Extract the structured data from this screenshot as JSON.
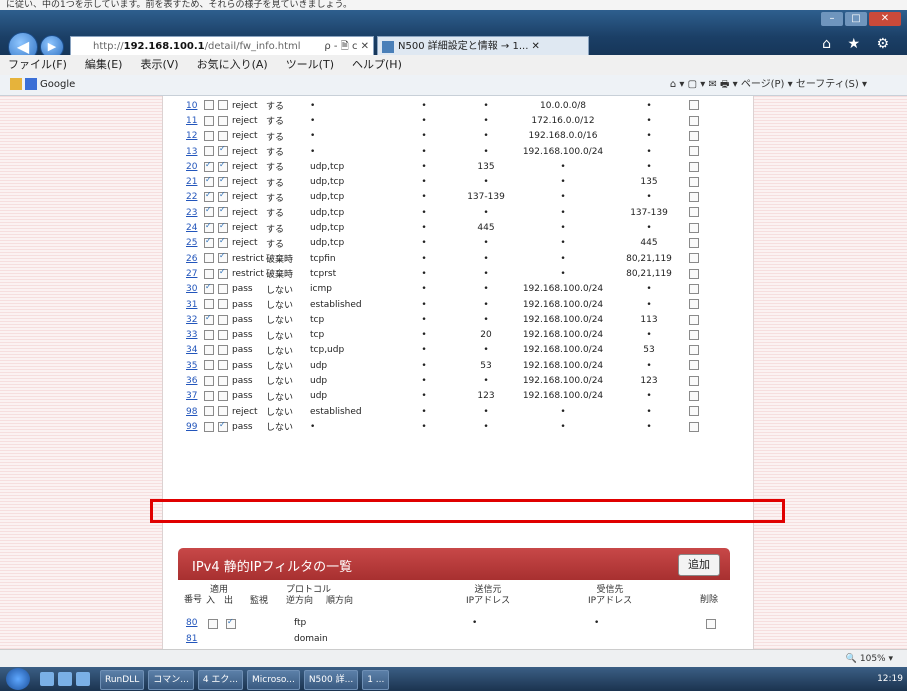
{
  "top_caption": "に従い、中の1つを示しています。前を表すため、それらの様子を見ていきましょう。",
  "window": {
    "minimize": "–",
    "maximize": "□",
    "close": "✕"
  },
  "nav": {
    "back": "◀",
    "forward": "▶"
  },
  "address": {
    "url_prefix": "http://",
    "host": "192.168.100.1",
    "path": "/detail/fw_info.html",
    "controls": "ρ - 🗎 c ✕"
  },
  "tab": {
    "title": "N500 詳細設定と情報 → 1... ✕"
  },
  "top_right_icons": "⌂ ★ ⚙",
  "menu": [
    "ファイル(F)",
    "編集(E)",
    "表示(V)",
    "お気に入り(A)",
    "ツール(T)",
    "ヘルプ(H)"
  ],
  "favorites": {
    "google": "Google"
  },
  "command_bar": "⌂ ▾  ▢ ▾  ✉  🖶 ▾  ページ(P) ▾  セーフティ(S) ▾",
  "rules": [
    {
      "num": "10",
      "in": false,
      "out": false,
      "action": "reject",
      "log": "する",
      "proto": "•",
      "mid": "•",
      "src_port": "•",
      "src_addr": "10.0.0.0/8",
      "dst_port": "•"
    },
    {
      "num": "11",
      "in": false,
      "out": false,
      "action": "reject",
      "log": "する",
      "proto": "•",
      "mid": "•",
      "src_port": "•",
      "src_addr": "172.16.0.0/12",
      "dst_port": "•"
    },
    {
      "num": "12",
      "in": false,
      "out": false,
      "action": "reject",
      "log": "する",
      "proto": "•",
      "mid": "•",
      "src_port": "•",
      "src_addr": "192.168.0.0/16",
      "dst_port": "•"
    },
    {
      "num": "13",
      "in": false,
      "out": true,
      "action": "reject",
      "log": "する",
      "proto": "•",
      "mid": "•",
      "src_port": "•",
      "src_addr": "192.168.100.0/24",
      "dst_port": "•"
    },
    {
      "num": "20",
      "in": true,
      "out": true,
      "action": "reject",
      "log": "する",
      "proto": "udp,tcp",
      "mid": "•",
      "src_port": "135",
      "src_addr": "•",
      "dst_port": "•"
    },
    {
      "num": "21",
      "in": true,
      "out": true,
      "action": "reject",
      "log": "する",
      "proto": "udp,tcp",
      "mid": "•",
      "src_port": "•",
      "src_addr": "•",
      "dst_port": "135"
    },
    {
      "num": "22",
      "in": true,
      "out": true,
      "action": "reject",
      "log": "する",
      "proto": "udp,tcp",
      "mid": "•",
      "src_port": "137-139",
      "src_addr": "•",
      "dst_port": "•"
    },
    {
      "num": "23",
      "in": true,
      "out": true,
      "action": "reject",
      "log": "する",
      "proto": "udp,tcp",
      "mid": "•",
      "src_port": "•",
      "src_addr": "•",
      "dst_port": "137-139"
    },
    {
      "num": "24",
      "in": true,
      "out": true,
      "action": "reject",
      "log": "する",
      "proto": "udp,tcp",
      "mid": "•",
      "src_port": "445",
      "src_addr": "•",
      "dst_port": "•"
    },
    {
      "num": "25",
      "in": true,
      "out": true,
      "action": "reject",
      "log": "する",
      "proto": "udp,tcp",
      "mid": "•",
      "src_port": "•",
      "src_addr": "•",
      "dst_port": "445"
    },
    {
      "num": "26",
      "in": false,
      "out": true,
      "action": "restrict",
      "log": "破棄時",
      "proto": "tcpfin",
      "mid": "•",
      "src_port": "•",
      "src_addr": "•",
      "dst_port": "80,21,119"
    },
    {
      "num": "27",
      "in": false,
      "out": true,
      "action": "restrict",
      "log": "破棄時",
      "proto": "tcprst",
      "mid": "•",
      "src_port": "•",
      "src_addr": "•",
      "dst_port": "80,21,119"
    },
    {
      "num": "30",
      "in": true,
      "out": false,
      "action": "pass",
      "log": "しない",
      "proto": "icmp",
      "mid": "•",
      "src_port": "•",
      "src_addr": "192.168.100.0/24",
      "dst_port": "•"
    },
    {
      "num": "31",
      "in": false,
      "out": false,
      "action": "pass",
      "log": "しない",
      "proto": "established",
      "mid": "•",
      "src_port": "•",
      "src_addr": "192.168.100.0/24",
      "dst_port": "•"
    },
    {
      "num": "32",
      "in": true,
      "out": false,
      "action": "pass",
      "log": "しない",
      "proto": "tcp",
      "mid": "•",
      "src_port": "•",
      "src_addr": "192.168.100.0/24",
      "dst_port": "113"
    },
    {
      "num": "33",
      "in": false,
      "out": false,
      "action": "pass",
      "log": "しない",
      "proto": "tcp",
      "mid": "•",
      "src_port": "20",
      "src_addr": "192.168.100.0/24",
      "dst_port": "•"
    },
    {
      "num": "34",
      "in": false,
      "out": false,
      "action": "pass",
      "log": "しない",
      "proto": "tcp,udp",
      "mid": "•",
      "src_port": "•",
      "src_addr": "192.168.100.0/24",
      "dst_port": "53"
    },
    {
      "num": "35",
      "in": false,
      "out": false,
      "action": "pass",
      "log": "しない",
      "proto": "udp",
      "mid": "•",
      "src_port": "53",
      "src_addr": "192.168.100.0/24",
      "dst_port": "•"
    },
    {
      "num": "36",
      "in": false,
      "out": false,
      "action": "pass",
      "log": "しない",
      "proto": "udp",
      "mid": "•",
      "src_port": "•",
      "src_addr": "192.168.100.0/24",
      "dst_port": "123"
    },
    {
      "num": "37",
      "in": false,
      "out": false,
      "action": "pass",
      "log": "しない",
      "proto": "udp",
      "mid": "•",
      "src_port": "123",
      "src_addr": "192.168.100.0/24",
      "dst_port": "•"
    },
    {
      "num": "98",
      "in": false,
      "out": false,
      "action": "reject",
      "log": "しない",
      "proto": "established",
      "mid": "•",
      "src_port": "•",
      "src_addr": "•",
      "dst_port": "•"
    },
    {
      "num": "99",
      "in": false,
      "out": true,
      "action": "pass",
      "log": "しない",
      "proto": "•",
      "mid": "•",
      "src_port": "•",
      "src_addr": "•",
      "dst_port": "•"
    }
  ],
  "panel": {
    "title": "IPv4 静的IPフィルタの一覧",
    "add_button": "追加",
    "col_num": "番号",
    "col_apply": "適用",
    "col_in": "入",
    "col_out": "出",
    "col_monitor": "監視",
    "col_protocol": "プロトコル",
    "col_reverse": "逆方向",
    "col_forward": "順方向",
    "col_src": "送信元\nIPアドレス",
    "col_dst": "受信先\nIPアドレス",
    "col_delete": "削除",
    "row1": {
      "num": "80",
      "in": false,
      "out": true,
      "proto": "ftp",
      "src": "•",
      "dst": "•"
    },
    "row2": {
      "num": "81",
      "proto": "domain"
    }
  },
  "status": {
    "zoom": "🔍 105%  ▾"
  },
  "taskbar": {
    "items": [
      "RunDLL",
      "コマン...",
      "4 エク...",
      "Microso...",
      "N500 詳...",
      "1 ..."
    ],
    "clock": "12:19"
  }
}
